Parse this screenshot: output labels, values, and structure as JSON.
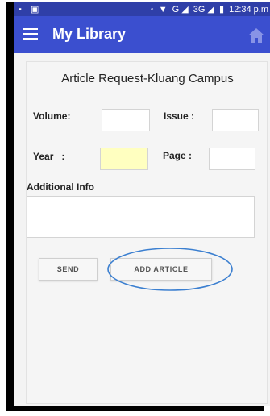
{
  "status_bar": {
    "left_icons": [
      "notification-icon",
      "image-icon"
    ],
    "right_icons": [
      "data-sync-icon",
      "wifi-icon",
      "signal-icon",
      "battery-icon"
    ],
    "network": "G",
    "network_secondary": "3G",
    "time": "12:34 p.m"
  },
  "app_bar": {
    "title": "My Library",
    "menu_icon": "hamburger-menu-icon",
    "home_icon": "home-icon",
    "color": "#3b4fcf"
  },
  "form": {
    "title": "Article Request-Kluang Campus",
    "volume_label": "Volume:",
    "issue_label": "Issue :",
    "year_label": "Year   :",
    "page_label": "Page :",
    "additional_info_label": "Additional Info",
    "volume_value": "",
    "issue_value": "",
    "year_value": "",
    "page_value": "",
    "additional_info_value": ""
  },
  "buttons": {
    "send_label": "SEND",
    "add_article_label": "ADD ARTICLE"
  },
  "colors": {
    "year_field_highlight": "#ffffc0",
    "annotation_circle": "#3b7fd0"
  }
}
